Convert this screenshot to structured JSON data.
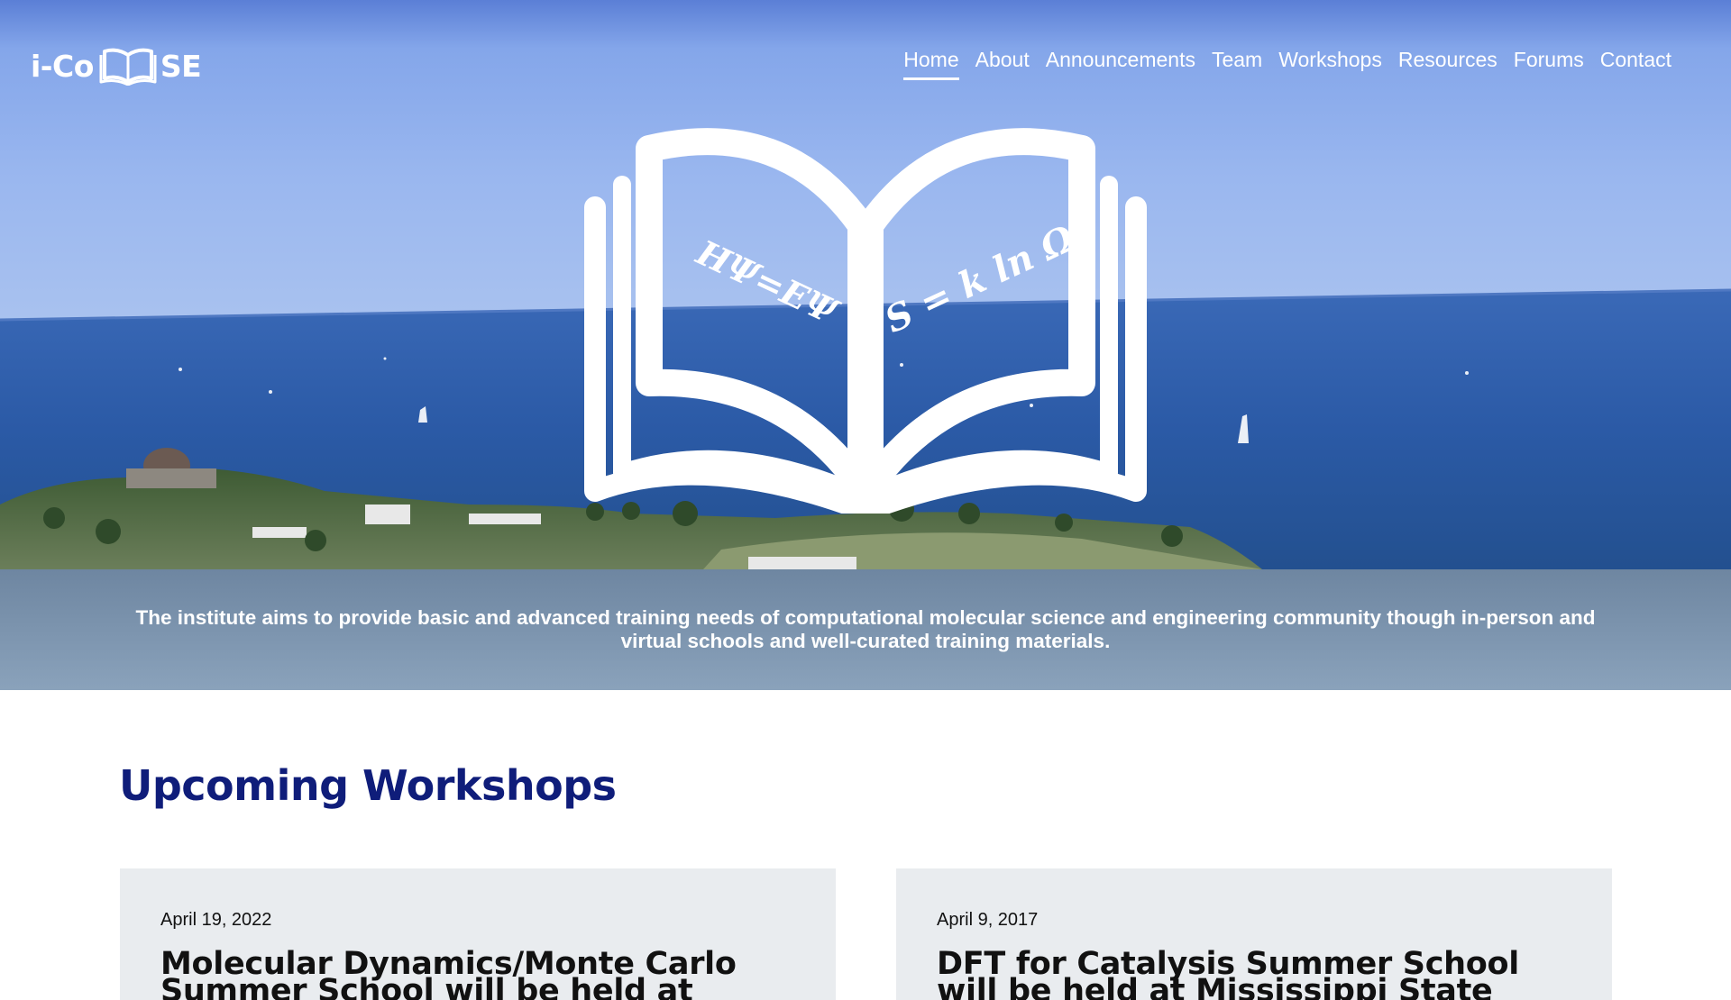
{
  "brand": {
    "prefix": "i-Co",
    "suffix": "SE"
  },
  "nav": {
    "items": [
      "Home",
      "About",
      "Announcements",
      "Team",
      "Workshops",
      "Resources",
      "Forums",
      "Contact"
    ],
    "active": "Home"
  },
  "hero": {
    "equation_left": "HΨ=EΨ",
    "equation_right": "S = k ln Ω"
  },
  "mission": {
    "text": "The institute aims to provide basic and advanced training needs of computational molecular science and engineering community though in-person and virtual schools and well-curated training materials."
  },
  "workshops": {
    "heading": "Upcoming Workshops",
    "cards": [
      {
        "date": "April 19, 2022",
        "title": "Molecular Dynamics/Monte Carlo Summer School will be held at Oklahoma"
      },
      {
        "date": "April 9, 2017",
        "title": "DFT for Catalysis Summer School will be held at Mississippi State University"
      }
    ]
  },
  "colors": {
    "heading": "#0f1d7a",
    "mission_band": "#7a92ab",
    "card_bg": "#e9ecef",
    "sky": "#8fb0e8",
    "sea": "#2f5fa8"
  },
  "icons": [
    "open-book-icon"
  ]
}
